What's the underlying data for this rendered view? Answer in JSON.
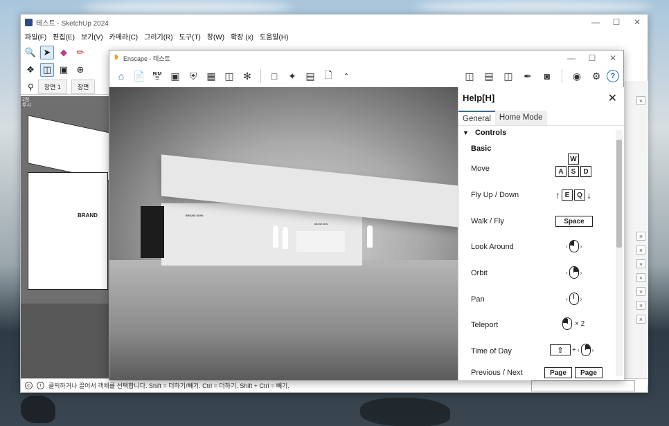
{
  "sketchup": {
    "window_title": "테스트 - SketchUp 2024",
    "menu": [
      "파일(F)",
      "편집(E)",
      "보기(V)",
      "카메라(C)",
      "그리기(R)",
      "도구(T)",
      "창(W)",
      "확장 (x)",
      "도움말(H)"
    ],
    "tabs": [
      "장면 1",
      "장면"
    ],
    "viewport_label": "2점\n투시",
    "brand_text": "BRAND",
    "status_text": "클릭하거나 끌어서 객체를 선택합니다. Shift = 더하기/빼기. Ctrl = 더하기. Shift + Ctrl = 빼기.",
    "controls": {
      "minimize": "—",
      "maximize": "☐",
      "close": "✕"
    }
  },
  "enscape": {
    "window_title": "Enscape - 테스트",
    "controls": {
      "minimize": "—",
      "maximize": "☐",
      "close": "✕"
    },
    "toolbar_bim_label": "BIM",
    "help_button": "?",
    "render_signs": {
      "sign1": "BRAND SIGN",
      "sign2": "BRAND SIGN"
    }
  },
  "help": {
    "title": "Help[H]",
    "close": "✕",
    "tabs": [
      {
        "label": "General",
        "active": true
      },
      {
        "label": "Home Mode",
        "active": false
      }
    ],
    "section": "Controls",
    "section_arrow": "▼",
    "subsection": "Basic",
    "rows": [
      {
        "label": "Move",
        "keys_top": "W",
        "keys": [
          "A",
          "S",
          "D"
        ]
      },
      {
        "label": "Fly Up / Down",
        "keys": [
          "E",
          "Q"
        ],
        "up": "↑",
        "down": "↓"
      },
      {
        "label": "Walk / Fly",
        "key": "Space"
      },
      {
        "label": "Look Around"
      },
      {
        "label": "Orbit"
      },
      {
        "label": "Pan"
      },
      {
        "label": "Teleport",
        "suffix": "× 2"
      },
      {
        "label": "Time of Day",
        "plus": "+"
      },
      {
        "label": "Previous / Next",
        "keys": [
          "Page",
          "Page"
        ]
      }
    ]
  },
  "colors": {
    "enscape_accent": "#1b6fc2",
    "enscape_logo": "#f29b16",
    "sketchup_accent": "#5a8fd1"
  }
}
